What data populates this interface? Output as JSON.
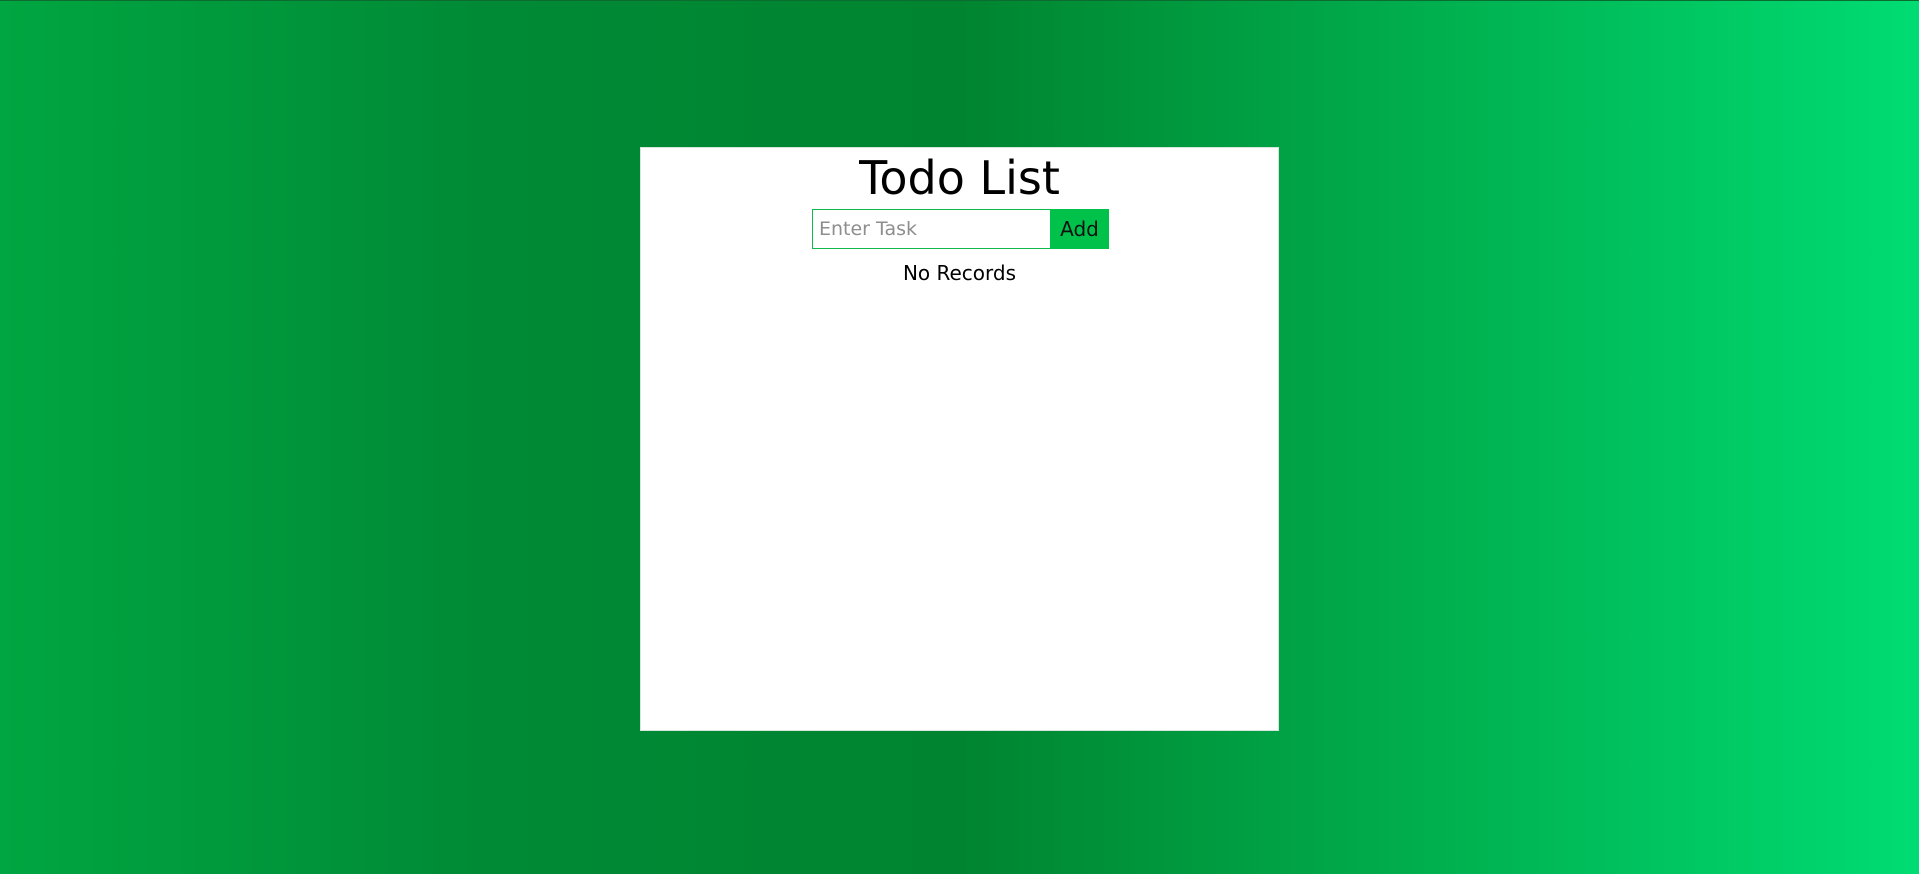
{
  "colors": {
    "gradient_start": "#00a641",
    "gradient_mid": "#00842f",
    "gradient_end": "#00dc73",
    "accent": "#00c24b",
    "card_background": "#ffffff"
  },
  "app": {
    "title": "Todo List"
  },
  "task_form": {
    "placeholder": "Enter Task",
    "value": "",
    "add_label": "Add"
  },
  "list": {
    "empty_message": "No Records"
  }
}
